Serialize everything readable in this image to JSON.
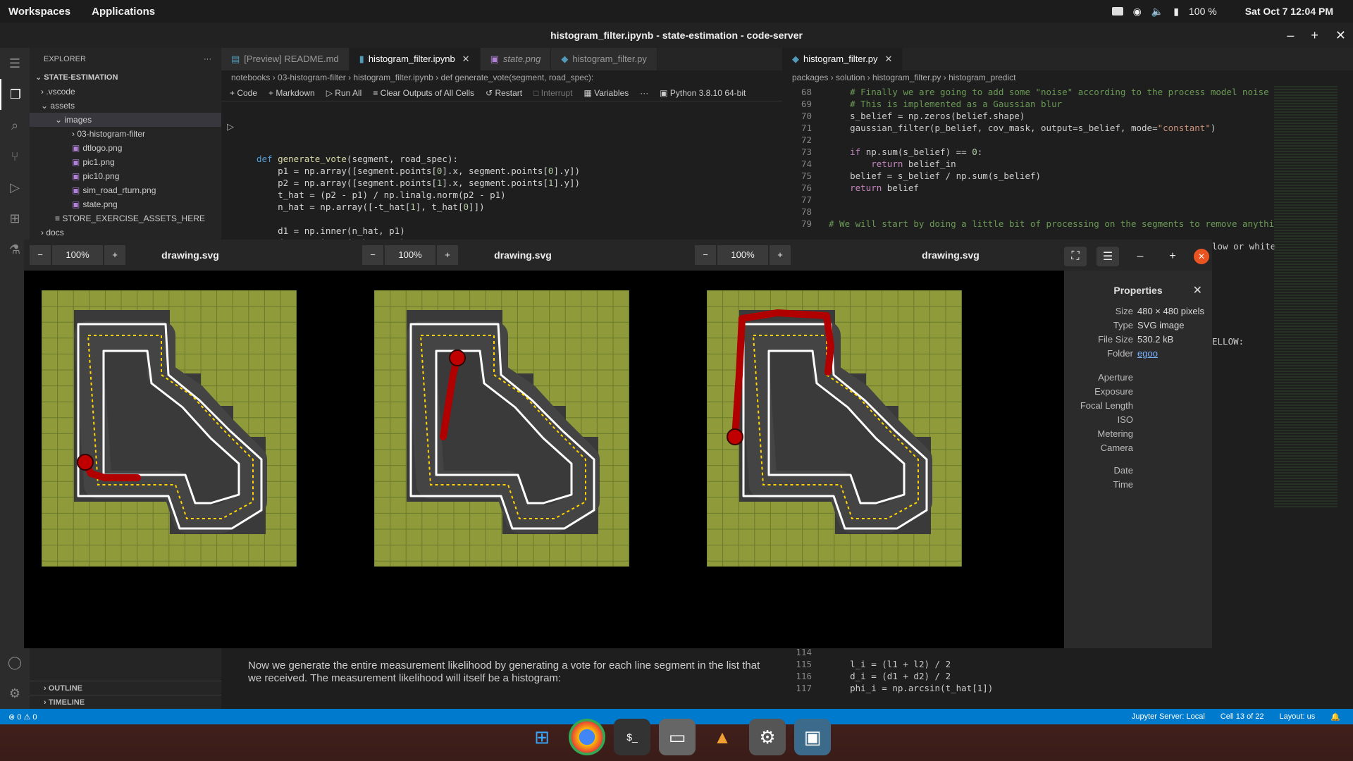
{
  "topbar": {
    "workspaces": "Workspaces",
    "applications": "Applications",
    "battery": "100 %",
    "clock": "Sat Oct 7  12:04 PM"
  },
  "window": {
    "title": "histogram_filter.ipynb - state-estimation - code-server"
  },
  "explorer": {
    "header": "EXPLORER",
    "root": "STATE-ESTIMATION",
    "items": [
      ".vscode",
      "assets",
      "images",
      "03-histogram-filter",
      "dtlogo.png",
      "pic1.png",
      "pic10.png",
      "sim_road_rturn.png",
      "state.png",
      "STORE_EXERCISE_ASSETS_HERE",
      "docs"
    ],
    "outline": "OUTLINE",
    "timeline": "TIMELINE"
  },
  "tabs_left": [
    {
      "label": "[Preview] README.md"
    },
    {
      "label": "histogram_filter.ipynb"
    },
    {
      "label": "state.png"
    },
    {
      "label": "histogram_filter.py"
    }
  ],
  "tabs_right": [
    {
      "label": "histogram_filter.py"
    }
  ],
  "notebook": {
    "breadcrumb": "notebooks › 03-histogram-filter › histogram_filter.ipynb › def generate_vote(segment, road_spec):",
    "toolbar": {
      "code": "+ Code",
      "markdown": "+ Markdown",
      "run_all": "Run All",
      "clear": "Clear Outputs of All Cells",
      "restart": "Restart",
      "interrupt": "Interrupt",
      "variables": "Variables",
      "kernel": "Python 3.8.10 64-bit"
    },
    "markdown_text": "Now we generate the entire measurement likelihood by generating a vote for each line segment in the list that we received. The measurement likelihood will itself be a histogram:"
  },
  "editor": {
    "breadcrumb": "packages › solution › histogram_filter.py › histogram_predict",
    "partial_text": "ELLOW:",
    "partial_text2": "low or white",
    "bottom_lines": [
      {
        "n": "114",
        "t": ""
      },
      {
        "n": "115",
        "t": "l_i = (l1 + l2) / 2"
      },
      {
        "n": "116",
        "t": "d_i = (d1 + d2) / 2"
      },
      {
        "n": "117",
        "t": "phi_i = np.arcsin(t_hat[1])"
      }
    ]
  },
  "viewers": [
    {
      "zoom": "100%",
      "title": "drawing.svg"
    },
    {
      "zoom": "100%",
      "title": "drawing.svg"
    },
    {
      "zoom": "100%",
      "title": "drawing.svg"
    }
  ],
  "properties": {
    "title": "Properties",
    "rows": [
      {
        "k": "Size",
        "v": "480 × 480 pixels"
      },
      {
        "k": "Type",
        "v": "SVG image"
      },
      {
        "k": "File Size",
        "v": "530.2 kB"
      },
      {
        "k": "Folder",
        "v": "egoo"
      },
      {
        "k": "Aperture",
        "v": ""
      },
      {
        "k": "Exposure",
        "v": ""
      },
      {
        "k": "Focal Length",
        "v": ""
      },
      {
        "k": "ISO",
        "v": ""
      },
      {
        "k": "Metering",
        "v": ""
      },
      {
        "k": "Camera",
        "v": ""
      },
      {
        "k": "Date",
        "v": ""
      },
      {
        "k": "Time",
        "v": ""
      }
    ]
  },
  "status": {
    "errors": "⊗ 0 ⚠ 0",
    "jupyter": "Jupyter Server: Local",
    "cell": "Cell 13 of 22",
    "layout": "Layout: us"
  },
  "colors": {
    "accent": "#007acc",
    "grass": "#8a9a3a",
    "road": "#3a3a3a",
    "red": "#c00000"
  }
}
